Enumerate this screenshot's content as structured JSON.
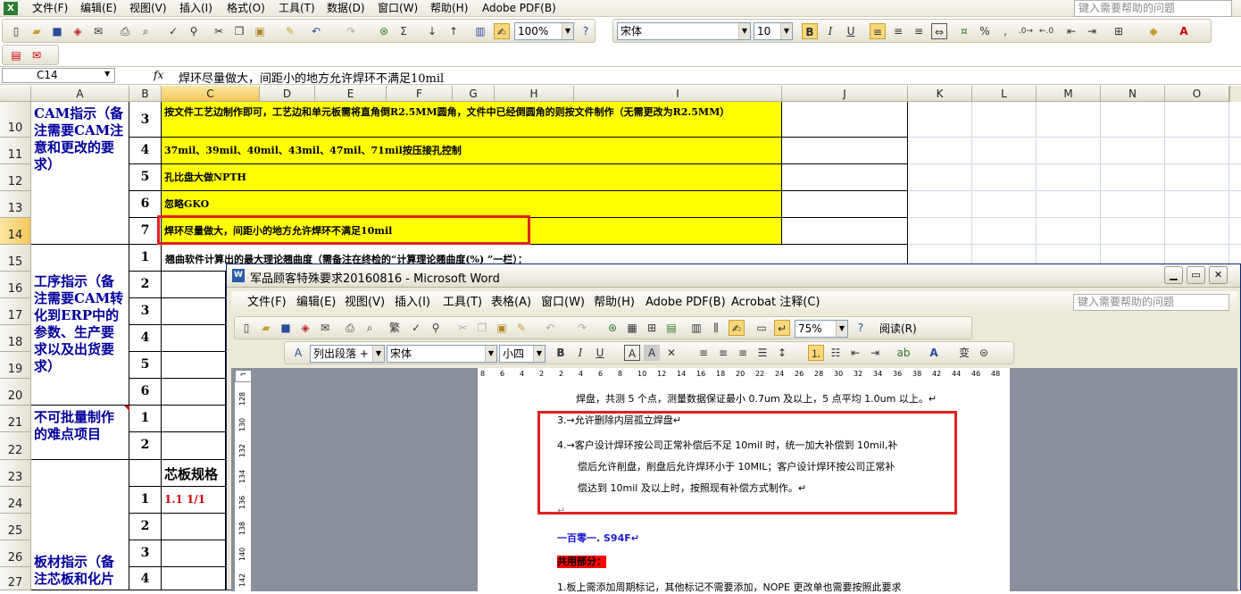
{
  "excel": {
    "menus": [
      "文件(F)",
      "编辑(E)",
      "视图(V)",
      "插入(I)",
      "格式(O)",
      "工具(T)",
      "数据(D)",
      "窗口(W)",
      "帮助(H)",
      "Adobe PDF(B)"
    ],
    "help_placeholder": "键入需要帮助的问题",
    "zoom": "100%",
    "font": "宋体",
    "font_size": "10",
    "bold_btn": "B",
    "italic_btn": "I",
    "underline_btn": "U",
    "percent_btn": "%",
    "comma_btn": ",",
    "name_box": "C14",
    "fx": "fx",
    "formula": "焊环尽量做大，间距小的地方允许焊环不满足10mil",
    "columns": [
      "A",
      "B",
      "C",
      "D",
      "E",
      "F",
      "G",
      "H",
      "I",
      "J",
      "K",
      "L",
      "M",
      "N",
      "O"
    ],
    "rows": [
      "10",
      "11",
      "12",
      "13",
      "14",
      "15",
      "16",
      "17",
      "18",
      "19",
      "20",
      "21",
      "22",
      "23",
      "24",
      "25",
      "26",
      "27"
    ],
    "cat1": "CAM指示（备注需要CAM注意和更改的要求）",
    "cat2": "工序指示（备注需要CAM转化到ERP中的参数、生产要求以及出货要求）",
    "cat3": "不可批量制作的难点项目",
    "cat4": "板材指示（备注芯板和化片",
    "nums": [
      "3",
      "4",
      "5",
      "6",
      "7",
      "1",
      "2",
      "3",
      "4",
      "5",
      "6",
      "1",
      "2",
      "",
      "1",
      "2",
      "3",
      "4"
    ],
    "yellow": [
      "按文件工艺边制作即可，工艺边和单元板需将直角倒R2.5MM圆角，文件中已经倒圆角的则按文件制作（无需更改为R2.5MM）",
      "37mil、39mil、40mil、43mil、47mil、71mil按压接孔控制",
      "孔比盘大做NPTH",
      "忽略GKO",
      "焊环尽量做大，间距小的地方允许焊环不满足10mil"
    ],
    "row15_text": "翘曲软件计算出的最大理论翘曲度（需备注在终检的“计算理论翘曲度(%) ”一栏）：",
    "row23_text": "芯板规格",
    "row24_text": "1.1 1/1"
  },
  "word": {
    "title": "军品顾客特殊要求20160816 - Microsoft Word",
    "menus": [
      "文件(F)",
      "编辑(E)",
      "视图(V)",
      "插入(I)",
      "工具(T)",
      "表格(A)",
      "窗口(W)",
      "帮助(H)",
      "Adobe PDF(B)",
      "Acrobat 注释(C)"
    ],
    "help_placeholder": "键入需要帮助的问题",
    "zoom": "75%",
    "read_btn": "阅读(R)",
    "style": "列出段落 +",
    "font": "宋体",
    "size": "小四",
    "b": "B",
    "i": "I",
    "u": "U",
    "ruler": [
      "8",
      "6",
      "4",
      "2",
      "2",
      "4",
      "6",
      "8",
      "10",
      "12",
      "14",
      "16",
      "18",
      "20",
      "22",
      "24",
      "26",
      "28",
      "30",
      "32",
      "34",
      "36",
      "38",
      "42",
      "44",
      "46",
      "48"
    ],
    "vruler": [
      "128",
      "130",
      "132",
      "134",
      "136",
      "138",
      "140",
      "142"
    ],
    "lines": [
      "焊盘，共测 5 个点，测量数据保证最小 0.7um 及以上，5 点平均 1.0um 以上。↵",
      "3.→允许删除内层孤立焊盘↵",
      "4.→客户设计焊环按公司正常补偿后不足 10mil 时，统一加大补偿到 10mil,补",
      "偿后允许削盘，削盘后允许焊环小于 10MIL；客户设计焊环按公司正常补",
      "偿达到 10mil 及以上时，按照现有补偿方式制作。↵",
      "↵",
      "一百零一. S94F↵",
      "共用部分：",
      "1.板上需添加周期标记，其他标记不需要添加，NOPE 更改单也需要按照此要求"
    ]
  }
}
